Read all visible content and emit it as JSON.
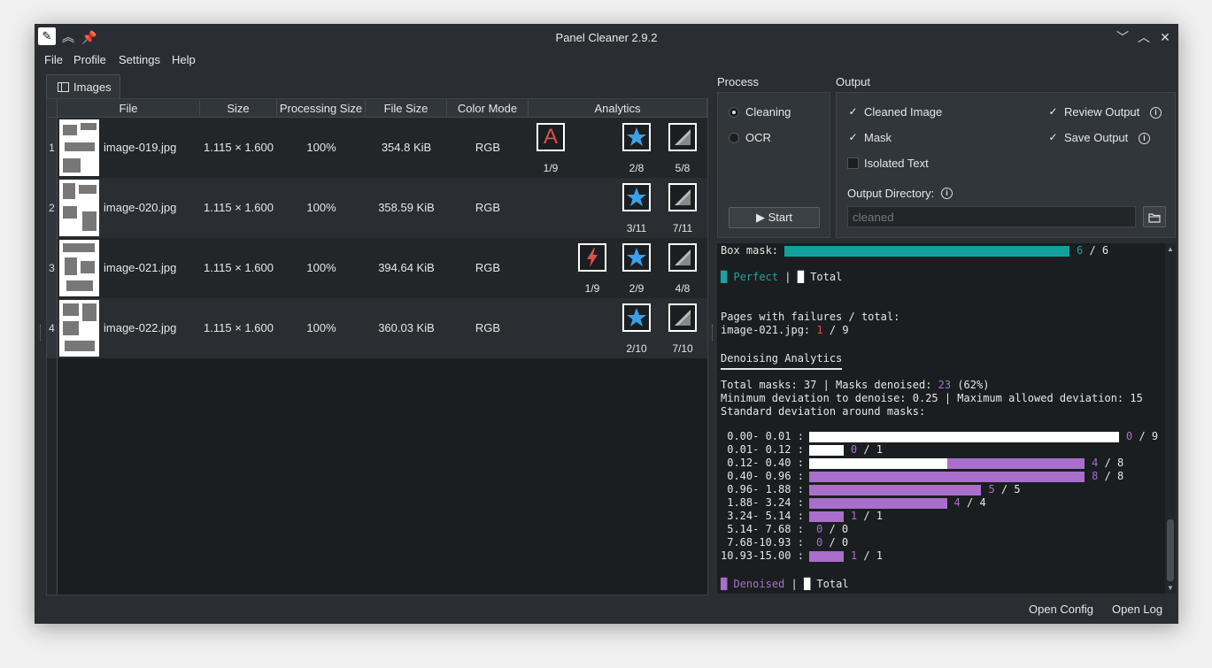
{
  "window": {
    "title": "Panel Cleaner 2.9.2"
  },
  "menu": [
    "File",
    "Profile",
    "Settings",
    "Help"
  ],
  "tab": {
    "label": "Images"
  },
  "table": {
    "headers": [
      "File",
      "Size",
      "Processing Size",
      "File Size",
      "Color Mode",
      "Analytics"
    ],
    "rows": [
      {
        "num": "1",
        "file": "image-019.jpg",
        "size": "1.115 × 1.600",
        "processing": "100%",
        "filesize": "354.8 KiB",
        "mode": "RGB",
        "analytics": [
          {
            "icon": "letter-a-icon",
            "label": "1/9"
          },
          {
            "icon": "star-icon",
            "label": "2/8"
          },
          {
            "icon": "mask-gradient-icon",
            "label": "5/8"
          }
        ]
      },
      {
        "num": "2",
        "file": "image-020.jpg",
        "size": "1.115 × 1.600",
        "processing": "100%",
        "filesize": "358.59 KiB",
        "mode": "RGB",
        "analytics": [
          {
            "icon": "star-icon",
            "label": "3/11"
          },
          {
            "icon": "mask-gradient-icon",
            "label": "7/11"
          }
        ]
      },
      {
        "num": "3",
        "file": "image-021.jpg",
        "size": "1.115 × 1.600",
        "processing": "100%",
        "filesize": "394.64 KiB",
        "mode": "RGB",
        "analytics": [
          {
            "icon": "lightning-icon",
            "label": "1/9"
          },
          {
            "icon": "star-icon",
            "label": "2/9"
          },
          {
            "icon": "mask-gradient-icon",
            "label": "4/8"
          }
        ]
      },
      {
        "num": "4",
        "file": "image-022.jpg",
        "size": "1.115 × 1.600",
        "processing": "100%",
        "filesize": "360.03 KiB",
        "mode": "RGB",
        "analytics": [
          {
            "icon": "star-icon",
            "label": "2/10"
          },
          {
            "icon": "mask-gradient-icon",
            "label": "7/10"
          }
        ]
      }
    ]
  },
  "process": {
    "label": "Process",
    "options": [
      {
        "label": "Cleaning",
        "selected": true
      },
      {
        "label": "OCR",
        "selected": false
      }
    ],
    "start_label": "Start"
  },
  "output": {
    "label": "Output",
    "cleaned_image": {
      "label": "Cleaned Image",
      "checked": true
    },
    "mask": {
      "label": "Mask",
      "checked": true
    },
    "isolated_text": {
      "label": "Isolated Text",
      "checked": false
    },
    "review_output": {
      "label": "Review Output",
      "checked": true
    },
    "save_output": {
      "label": "Save Output",
      "checked": true
    },
    "dir_label": "Output Directory:",
    "dir_placeholder": "cleaned"
  },
  "console": {
    "box_mask_label": "Box mask:",
    "box_mask_value": "6",
    "box_mask_total": "6",
    "legend1_perfect": "Perfect",
    "legend1_total": "Total",
    "failures_title": "Pages with failures / total:",
    "failures_file": "image-021.jpg:",
    "failures_count": "1",
    "failures_total": "9",
    "denoise_title": "Denoising Analytics",
    "total_masks_line_a": "Total masks: 37 | Masks denoised: ",
    "masks_denoised": "23",
    "total_masks_line_b": " (62%)",
    "deviation_line": "Minimum deviation to denoise: 0.25 | Maximum allowed deviation: 15",
    "std_line": "Standard deviation around masks:",
    "histogram": [
      {
        "range": " 0.00- 0.01 :",
        "denoised": 0,
        "total": 9
      },
      {
        "range": " 0.01- 0.12 :",
        "denoised": 0,
        "total": 1
      },
      {
        "range": " 0.12- 0.40 :",
        "denoised": 4,
        "total": 8
      },
      {
        "range": " 0.40- 0.96 :",
        "denoised": 8,
        "total": 8
      },
      {
        "range": " 0.96- 1.88 :",
        "denoised": 5,
        "total": 5
      },
      {
        "range": " 1.88- 3.24 :",
        "denoised": 4,
        "total": 4
      },
      {
        "range": " 3.24- 5.14 :",
        "denoised": 1,
        "total": 1
      },
      {
        "range": " 5.14- 7.68 :",
        "denoised": 0,
        "total": 0
      },
      {
        "range": " 7.68-10.93 :",
        "denoised": 0,
        "total": 0
      },
      {
        "range": "10.93-15.00 :",
        "denoised": 1,
        "total": 1
      }
    ],
    "legend2_denoised": "Denoised",
    "legend2_total": "Total"
  },
  "footer": {
    "open_config": "Open Config",
    "open_log": "Open Log"
  },
  "colors": {
    "teal": "#1aa3a3",
    "purple": "#a96fcc",
    "red": "#dc5050",
    "star_blue": "#3ba0e6"
  }
}
